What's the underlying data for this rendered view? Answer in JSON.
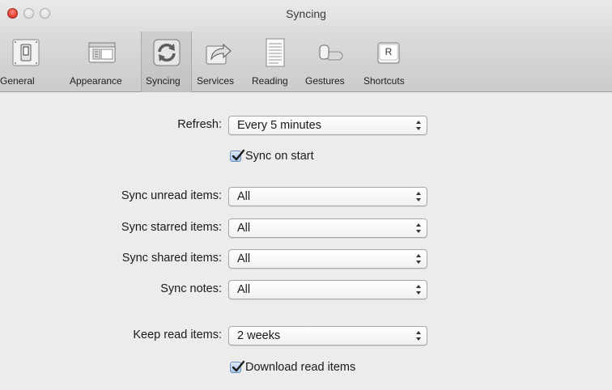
{
  "window": {
    "title": "Syncing"
  },
  "toolbar": {
    "items": [
      {
        "label": "General",
        "icon": "switch-icon"
      },
      {
        "label": "Appearance",
        "icon": "window-layout-icon"
      },
      {
        "label": "Syncing",
        "icon": "sync-icon",
        "selected": true
      },
      {
        "label": "Services",
        "icon": "share-arrow-icon"
      },
      {
        "label": "Reading",
        "icon": "document-icon"
      },
      {
        "label": "Gestures",
        "icon": "toggle-icon"
      },
      {
        "label": "Shortcuts",
        "icon": "key-icon",
        "key_glyph": "R"
      }
    ]
  },
  "form": {
    "refresh": {
      "label": "Refresh:",
      "value": "Every 5 minutes"
    },
    "sync_on_start": {
      "label": "Sync on start",
      "checked": true
    },
    "sync_unread": {
      "label": "Sync unread items:",
      "value": "All"
    },
    "sync_starred": {
      "label": "Sync starred items:",
      "value": "All"
    },
    "sync_shared": {
      "label": "Sync shared items:",
      "value": "All"
    },
    "sync_notes": {
      "label": "Sync notes:",
      "value": "All"
    },
    "keep_read": {
      "label": "Keep read items:",
      "value": "2 weeks"
    },
    "download_read": {
      "label": "Download read items",
      "checked": true
    }
  },
  "colors": {
    "checkbox_accent": "#2a62b8",
    "close_button": "#e0443a"
  }
}
